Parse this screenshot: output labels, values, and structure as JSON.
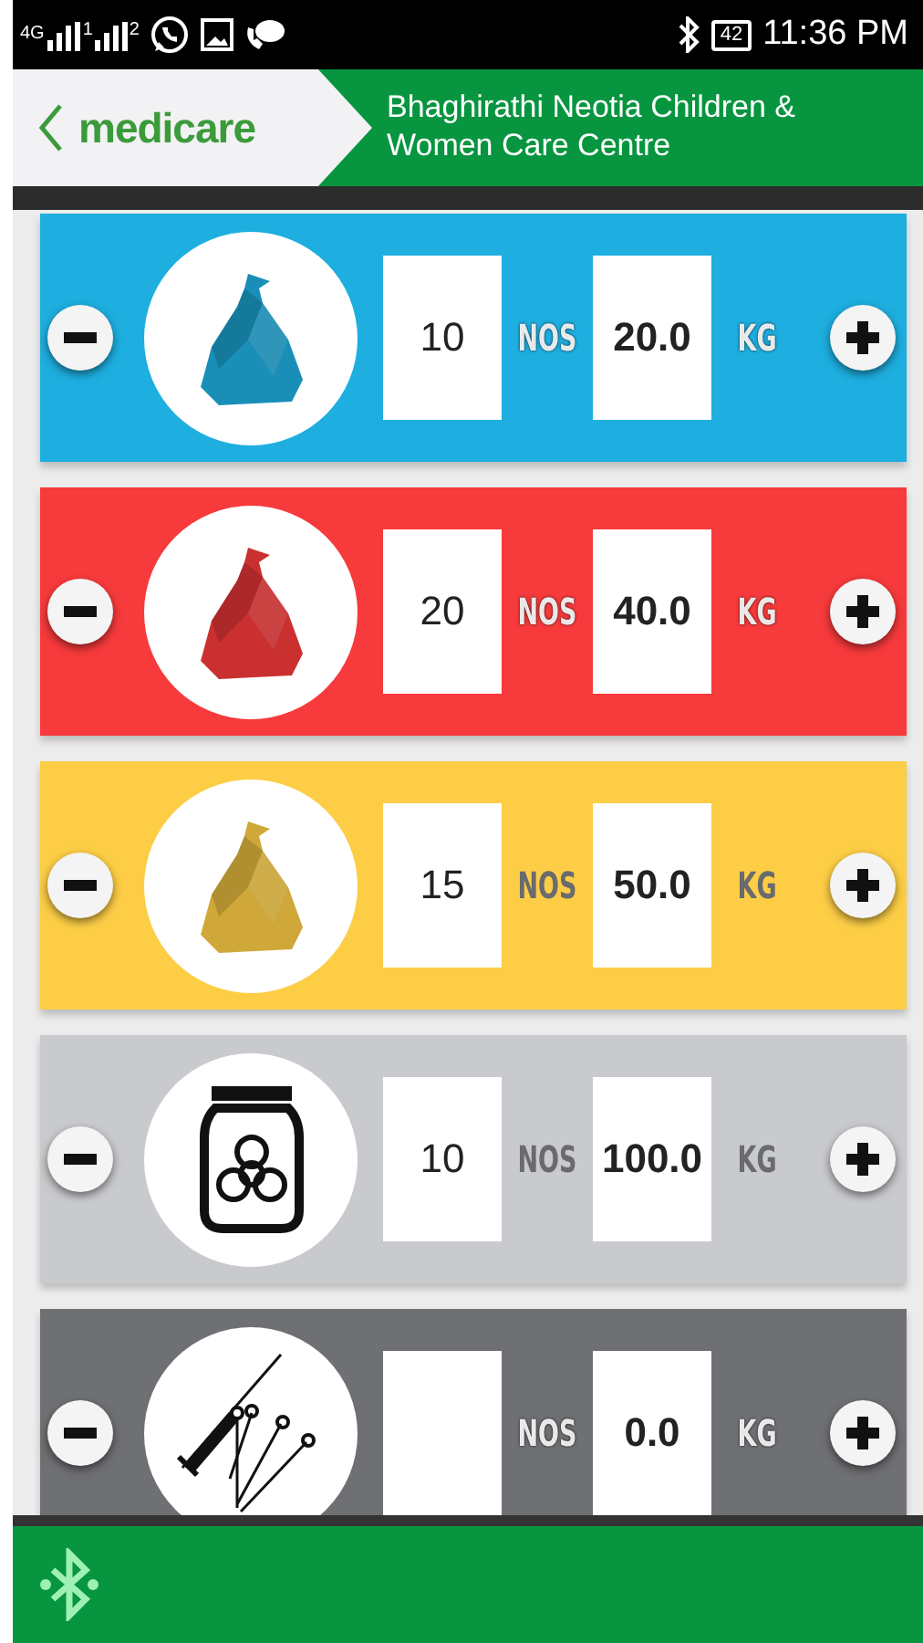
{
  "status_bar": {
    "network": "4G",
    "sim_1": "1",
    "sim_2": "2",
    "battery": "42",
    "time": "11:36 PM"
  },
  "header": {
    "logo": "medicare",
    "title": "Bhaghirathi Neotia Children & Women Care Centre"
  },
  "rows": [
    {
      "kind": "bag",
      "color": "#1eaee0",
      "count": "10",
      "count_unit": "NOS",
      "weight": "20.0",
      "weight_unit": "KG"
    },
    {
      "kind": "bag",
      "color": "#f73a3b",
      "count": "20",
      "count_unit": "NOS",
      "weight": "40.0",
      "weight_unit": "KG"
    },
    {
      "kind": "bag",
      "color": "#fccd45",
      "count": "15",
      "count_unit": "NOS",
      "weight": "50.0",
      "weight_unit": "KG"
    },
    {
      "kind": "jar",
      "color": "#c9cacd",
      "count": "10",
      "count_unit": "NOS",
      "weight": "100.0",
      "weight_unit": "KG"
    },
    {
      "kind": "sharps",
      "color": "#6f7073",
      "count_unit": "NOS",
      "weight": "0.0",
      "weight_unit": "KG"
    }
  ]
}
